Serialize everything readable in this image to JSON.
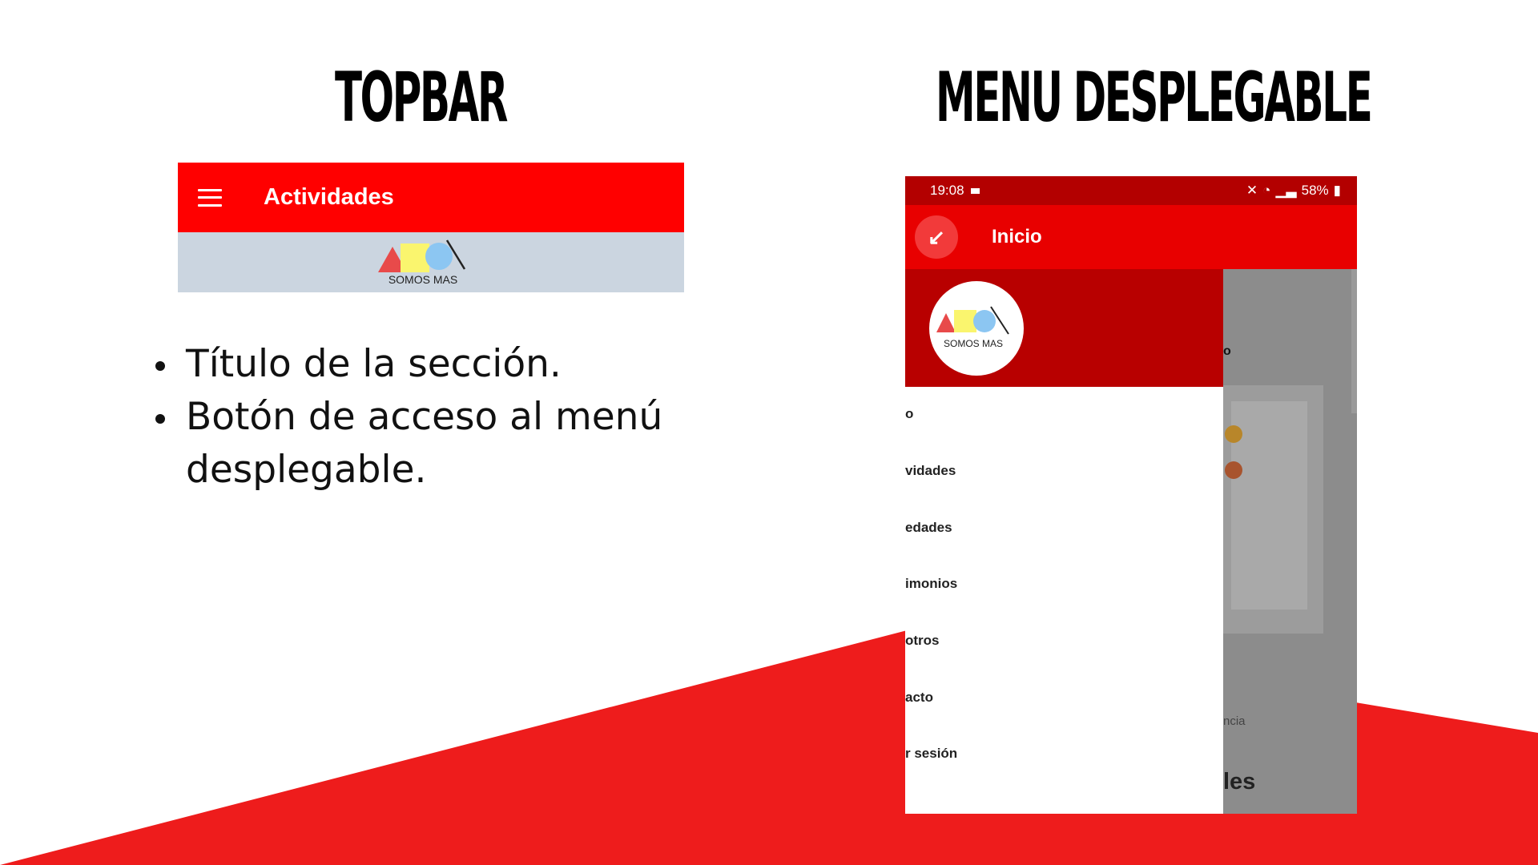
{
  "headings": {
    "topbar": "TOPBAR",
    "menu": "MENU DESPLEGABLE"
  },
  "topbar_mock": {
    "title": "Actividades",
    "logo_text": "SOMOS MAS"
  },
  "bullets": [
    "Título de la sección.",
    "Botón de acceso al menú desplegable."
  ],
  "phone": {
    "status": {
      "time": "19:08",
      "battery": "58%"
    },
    "appbar_title": "Inicio",
    "logo_text": "SOMOS MAS",
    "menu_items": [
      "o",
      "vidades",
      "edades",
      "imonios",
      "otros",
      "acto",
      "r sesión"
    ],
    "behind": {
      "o": "o",
      "ncia": "ncia",
      "les": "les"
    }
  },
  "colors": {
    "accent_red": "#ff0000",
    "band_red": "#ee1c1c",
    "dark_red": "#b80000"
  }
}
